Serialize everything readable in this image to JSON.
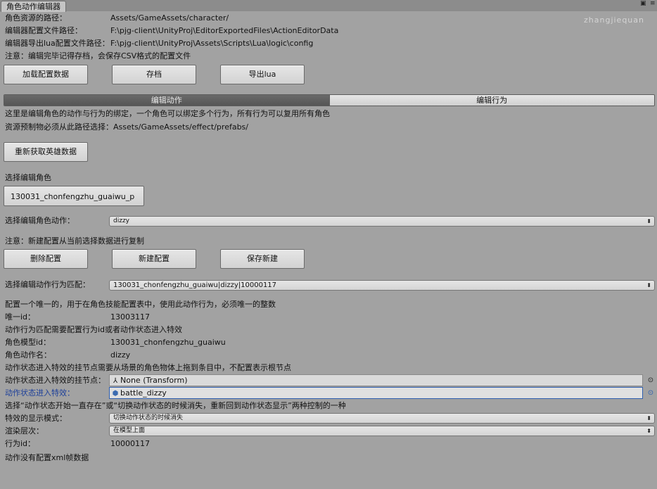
{
  "window": {
    "tab_title": "角色动作编辑器",
    "watermark": "zhangjiequan"
  },
  "paths": [
    {
      "label": "角色资源的路径：",
      "value": "Assets/GameAssets/character/"
    },
    {
      "label": "编辑器配置文件路径：",
      "value": "F:\\pjg-client\\UnityProj\\EditorExportedFiles\\ActionEditorData"
    },
    {
      "label": "编辑器导出lua配置文件路径：",
      "value": "F:\\pjg-client\\UnityProj\\Assets\\Scripts\\Lua\\logic\\config"
    }
  ],
  "save_note": "注意：编辑完毕记得存档，会保存CSV格式的配置文件",
  "toolbar": {
    "load_label": "加载配置数据",
    "save_label": "存档",
    "export_label": "导出lua"
  },
  "mode_tabs": [
    "编辑动作",
    "编辑行为"
  ],
  "intro_lines": [
    "这里是编辑角色的动作与行为的绑定，一个角色可以绑定多个行为，所有行为可以复用所有角色",
    "资源预制物必须从此路径选择：Assets/GameAssets/effect/prefabs/"
  ],
  "refresh_heroes_label": "重新获取英雄数据",
  "role_section": {
    "label": "选择编辑角色",
    "selected_role": "130031_chonfengzhu_guaiwu_p"
  },
  "action_select": {
    "label": "选择编辑角色动作：",
    "value": "dizzy"
  },
  "new_config_note": "注意：新建配置从当前选择数据进行复制",
  "config_buttons": {
    "delete_label": "删除配置",
    "new_label": "新建配置",
    "save_new_label": "保存新建"
  },
  "behavior_match": {
    "label": "选择编辑动作行为匹配：",
    "value": "130031_chonfengzhu_guaiwu|dizzy|10000117"
  },
  "detail": {
    "unique_note": "配置一个唯一的，用于在角色技能配置表中，使用此动作行为，必须唯一的整数",
    "unique_id_label": "唯一id：",
    "unique_id_value": "13003117",
    "match_note": "动作行为匹配需要配置行为id或者动作状态进入特效",
    "model_id_label": "角色模型id：",
    "model_id_value": "130031_chonfengzhu_guaiwu",
    "action_name_label": "角色动作名：",
    "action_name_value": "dizzy",
    "mount_note": "动作状态进入特效的挂节点需要从场景的角色物体上拖到条目中，不配置表示根节点",
    "mount_label": "动作状态进入特效的挂节点：",
    "mount_value": "None (Transform)",
    "effect_label": "动作状态进入特效：",
    "effect_value": "battle_dizzy",
    "display_mode_note": "选择“动作状态开始一直存在”或“切换动作状态的时候消失，重新回到动作状态显示”两种控制的一种",
    "display_mode_label": "特效的显示模式：",
    "display_mode_value": "切换动作状态的时候消失",
    "render_layer_label": "渲染层次：",
    "render_layer_value": "在模型上面",
    "behavior_id_label": "行为id：",
    "behavior_id_value": "10000117",
    "xml_note": "动作没有配置xml帧数据"
  },
  "colors": {
    "background": "#a2a2a2",
    "focus_label": "#1c3f9a",
    "active_tab": "#5e5e5e"
  },
  "icons": [
    "transform-icon",
    "prefab-icon",
    "object-picker-icon",
    "dropdown-arrow-icon"
  ]
}
